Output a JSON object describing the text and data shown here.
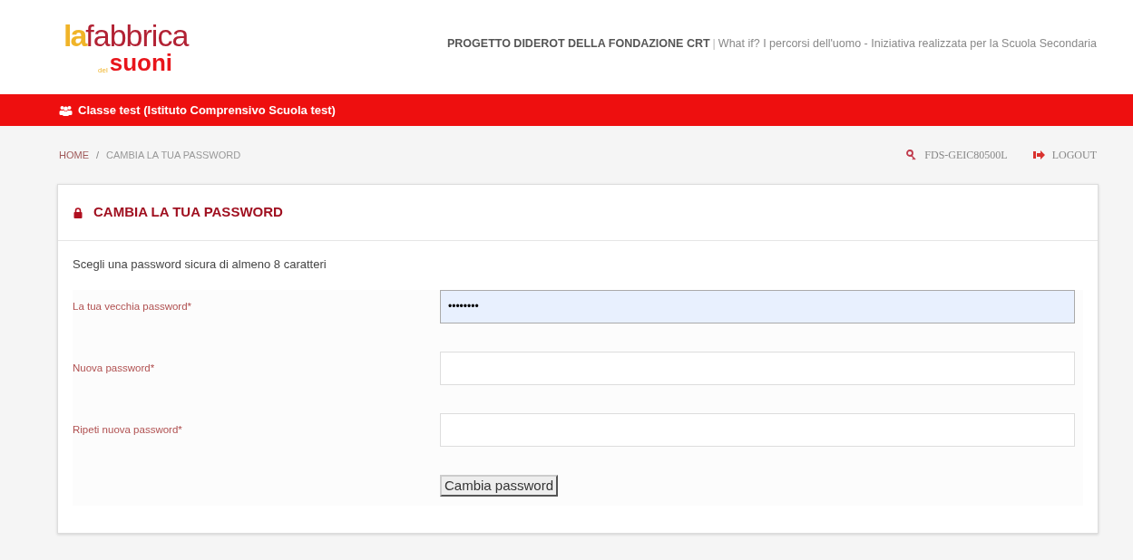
{
  "logo": {
    "part_1": "la",
    "part_2": "fabbrica",
    "part_3": "del",
    "part_4": "suoni"
  },
  "header": {
    "project": "PROGETTO DIDEROT DELLA FONDAZIONE CRT",
    "separator": "|",
    "tagline": "What if? I percorsi dell'uomo - Iniziativa realizzata per la Scuola Secondaria"
  },
  "class_bar": {
    "label": "Classe test (Istituto Comprensivo Scuola test)"
  },
  "breadcrumb": [
    {
      "label": "HOME"
    },
    {
      "label": "/"
    },
    {
      "label": "CAMBIA LA TUA PASSWORD"
    }
  ],
  "user_links": [
    {
      "kind": "user",
      "label": "FDS-GEIC80500L"
    },
    {
      "kind": "logout",
      "label": "LOGOUT"
    }
  ],
  "card": {
    "title": "CAMBIA LA TUA PASSWORD",
    "intro": "Scegli una password sicura di almeno 8 caratteri",
    "fields": [
      {
        "label": "La tua vecchia password*",
        "value": "••••••••",
        "focused": true
      },
      {
        "label": "Nuova password*",
        "focused": false
      },
      {
        "label": "Ripeti nuova password*",
        "focused": false
      }
    ],
    "submit": "Cambia password"
  }
}
